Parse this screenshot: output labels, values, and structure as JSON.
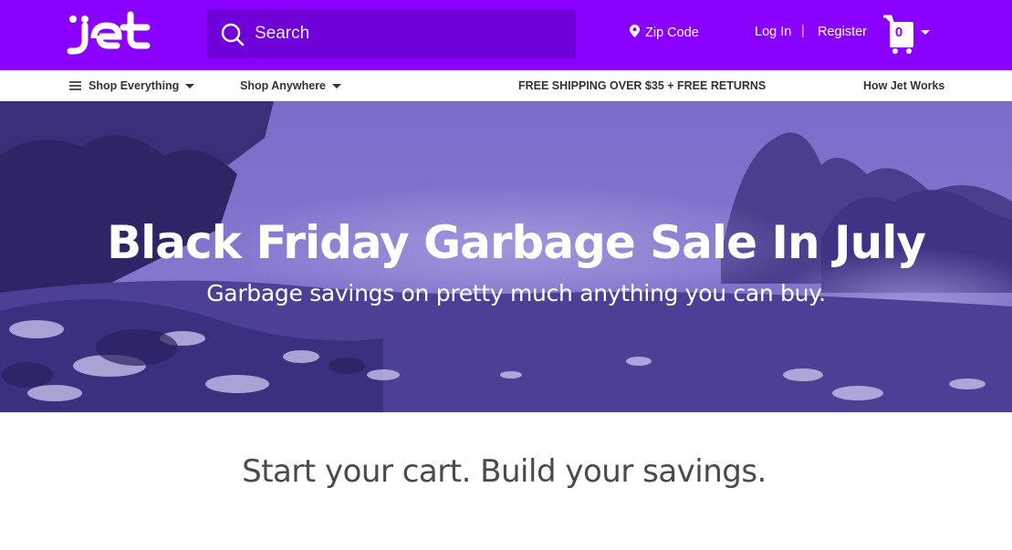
{
  "header": {
    "logo_text": "jet",
    "search": {
      "placeholder": "Search",
      "value": ""
    },
    "zip_label": "Zip Code",
    "login_label": "Log In",
    "separator": "|",
    "register_label": "Register",
    "cart_count": "0",
    "colors": {
      "brand": "#8a00ff",
      "search_bg": "#6f00d8"
    }
  },
  "subnav": {
    "shop_everything": "Shop Everything",
    "shop_anywhere": "Shop Anywhere",
    "promo": "FREE SHIPPING OVER $35 + FREE RETURNS",
    "how_it_works": "How Jet Works"
  },
  "hero": {
    "title": "Black Friday Garbage Sale In July",
    "subtitle": "Garbage savings on pretty much anything you can buy."
  },
  "tagline": "Start your cart. Build your savings."
}
